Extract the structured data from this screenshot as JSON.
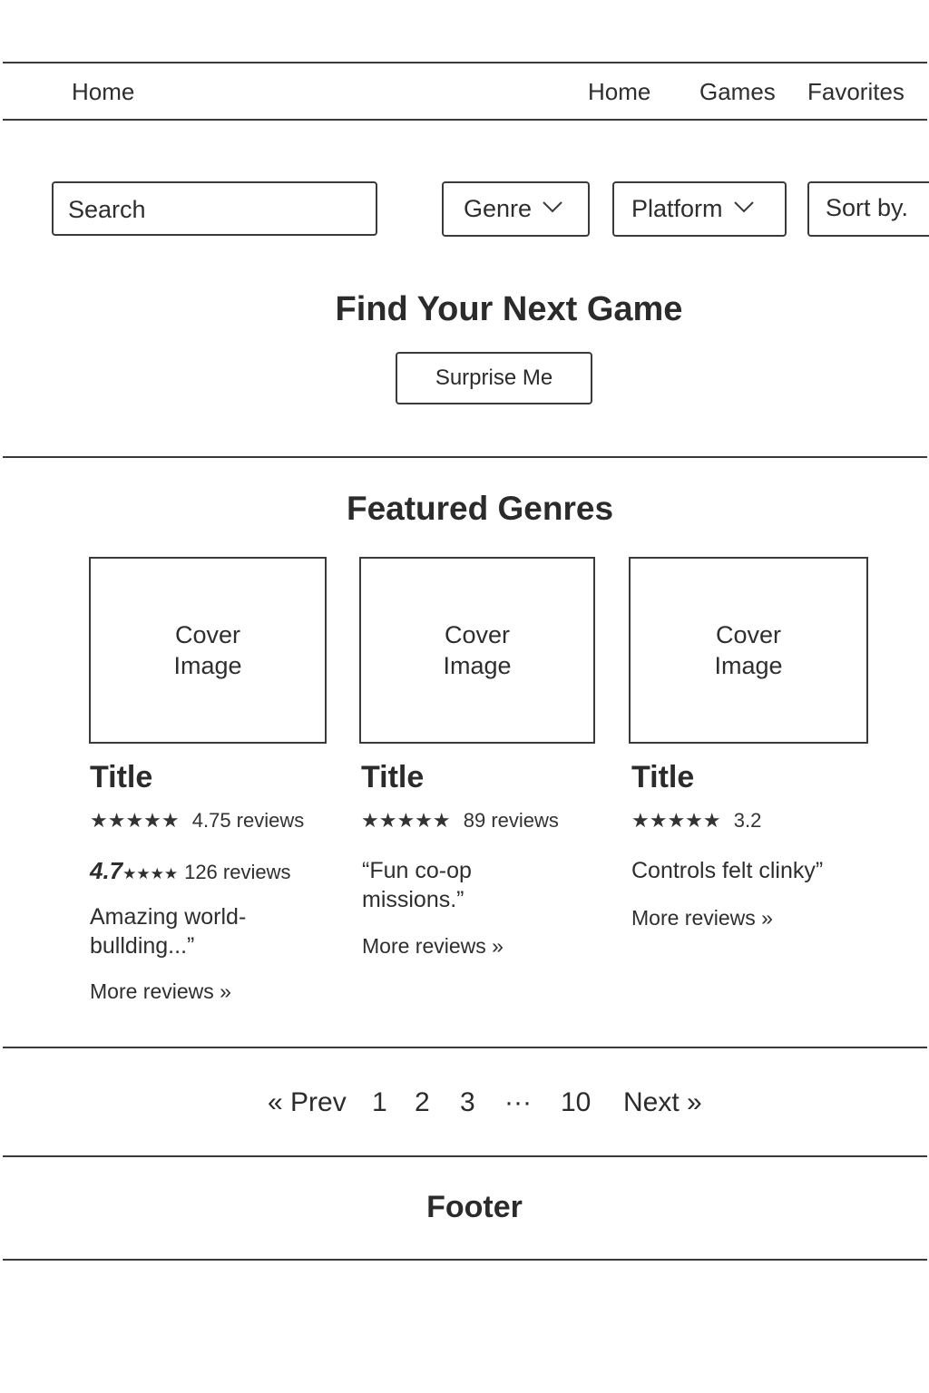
{
  "nav": {
    "brand": "Home",
    "links": [
      "Home",
      "Games",
      "Favorites"
    ]
  },
  "filters": {
    "search_placeholder": "Search",
    "genre": "Genre",
    "platform": "Platform",
    "sort": "Sort by."
  },
  "hero": {
    "title": "Find Your Next Game",
    "button": "Surprise Me"
  },
  "featured": {
    "title": "Featured Genres",
    "cards": [
      {
        "cover_line1": "Cover",
        "cover_line2": "Image",
        "title": "Title",
        "stars": "★★★★★",
        "rating_text": "4.75 reviews",
        "extra_rating_num": "4.7",
        "extra_stars": "★★★★",
        "extra_reviews": "126 reviews",
        "quote_line1": "Amazing world-",
        "quote_line2": "bullding...”",
        "more": "More reviews »"
      },
      {
        "cover_line1": "Cover",
        "cover_line2": "Image",
        "title": "Title",
        "stars": "★★★★★",
        "rating_text": "89 reviews",
        "quote_line1": "“Fun co-op",
        "quote_line2": "missions.”",
        "more": "More reviews »"
      },
      {
        "cover_line1": "Cover",
        "cover_line2": "Image",
        "title": "Title",
        "stars": "★★★★★",
        "rating_text": "3.2",
        "quote_line1": "Controls felt clinky”",
        "more": "More reviews »"
      }
    ]
  },
  "pagination": {
    "prev": "« Prev",
    "pages": [
      "1",
      "2",
      "3",
      "···",
      "10"
    ],
    "next": "Next »"
  },
  "footer": {
    "title": "Footer"
  }
}
